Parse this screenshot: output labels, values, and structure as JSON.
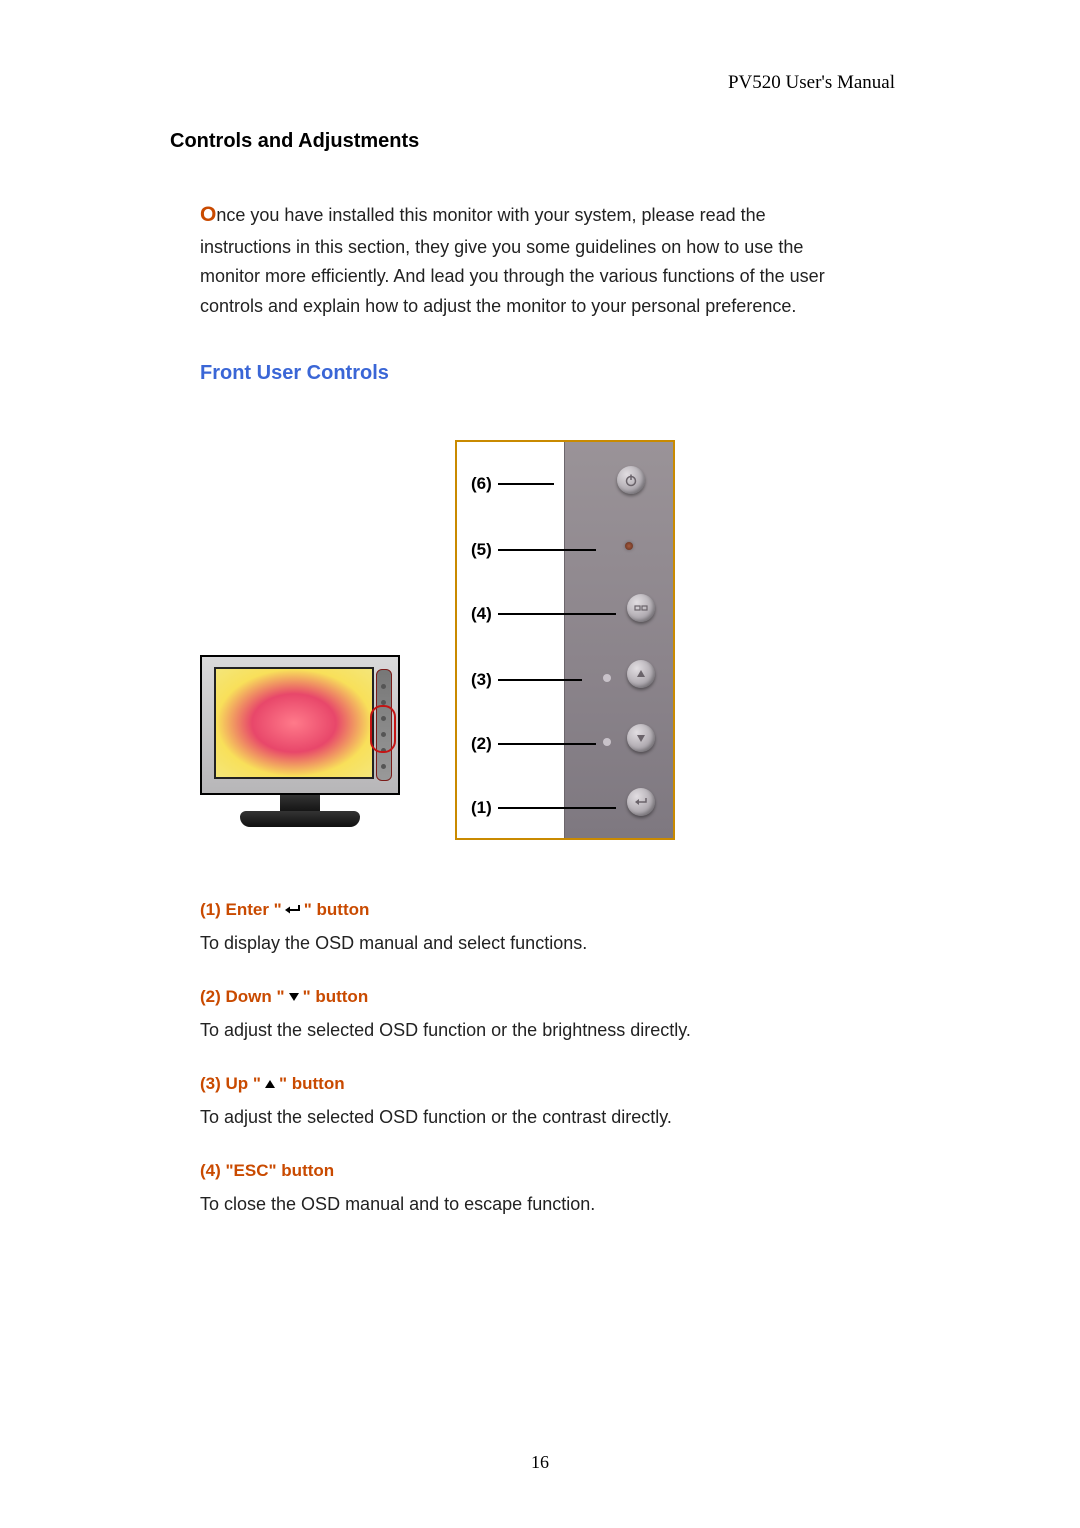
{
  "header": {
    "model": "PV520",
    "title_suffix": " User's Manual"
  },
  "section_title": "Controls and Adjustments",
  "intro": {
    "dropcap": "O",
    "rest": "nce you have installed this monitor with your system, please read the instructions in this section, they give you some guidelines on how to use the monitor more efficiently. And lead you through the various functions of the user controls and explain how to adjust the monitor to your personal preference."
  },
  "subheading": "Front User Controls",
  "callouts": [
    "(6)",
    "(5)",
    "(4)",
    "(3)",
    "(2)",
    "(1)"
  ],
  "controls": [
    {
      "title_pre": "(1) Enter \"",
      "symbol": "enter",
      "title_post": "\" button",
      "body": "To display the OSD manual and select functions."
    },
    {
      "title_pre": "(2) Down \"",
      "symbol": "down",
      "title_post": "\" button",
      "body": "To adjust the selected OSD function or the brightness directly."
    },
    {
      "title_pre": "(3) Up \"",
      "symbol": "up",
      "title_post": "\" button",
      "body": "To adjust the selected OSD function or the contrast directly."
    },
    {
      "title_pre": "(4) \"ESC\" button",
      "symbol": "",
      "title_post": "",
      "body": "To close the OSD manual and to escape function."
    }
  ],
  "page_number": "16"
}
